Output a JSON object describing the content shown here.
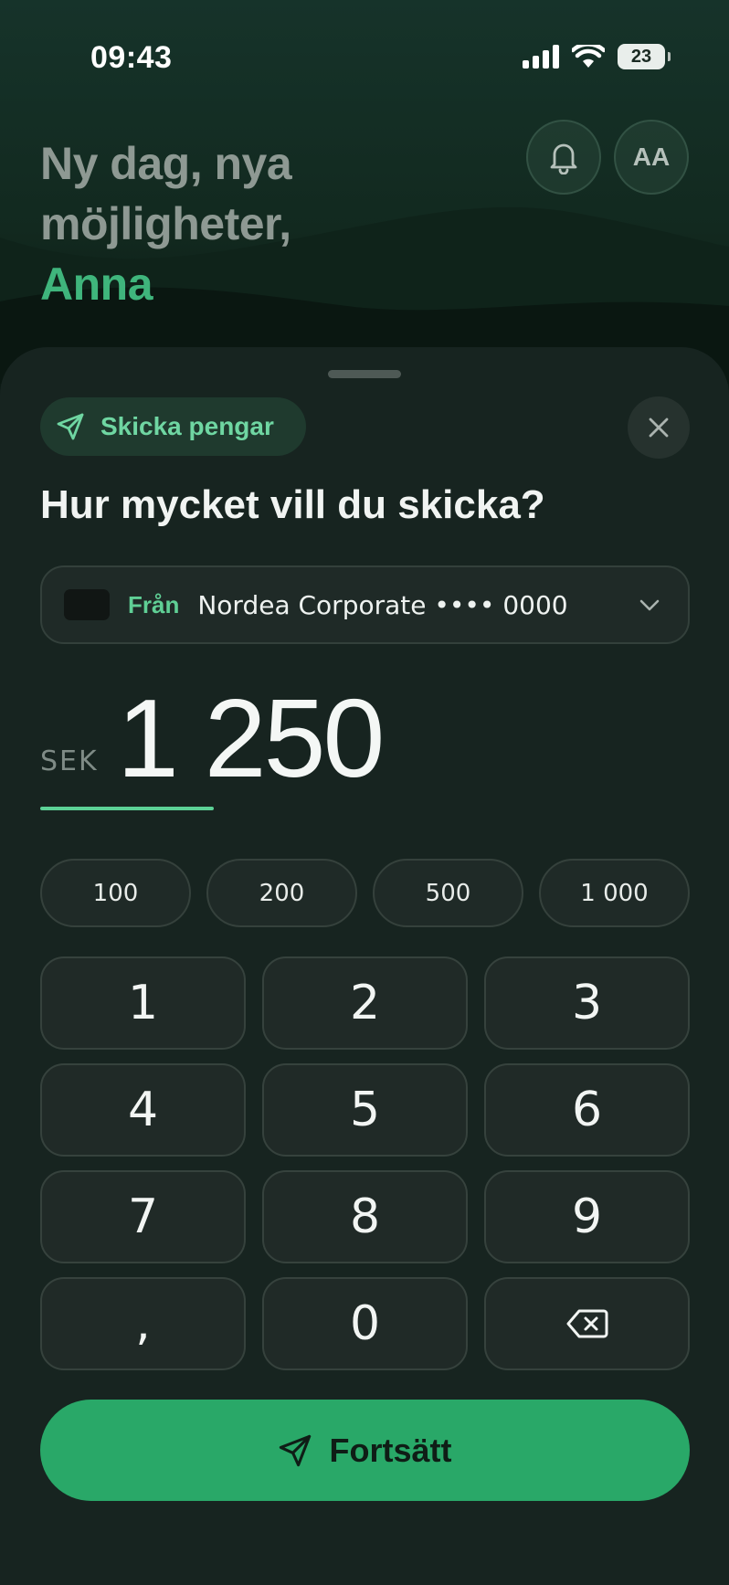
{
  "status_bar": {
    "time": "09:43",
    "battery": "23",
    "icons": [
      "signal-icon",
      "wifi-icon",
      "battery-icon"
    ]
  },
  "header": {
    "greeting_line1": "Ny dag, nya",
    "greeting_line2": "möjligheter,",
    "name": "Anna",
    "bell_icon": "bell-icon",
    "avatar_initials": "AA"
  },
  "sheet": {
    "chip_label": "Skicka pengar",
    "chip_icon": "send-icon",
    "close_icon": "close-icon",
    "question": "Hur mycket vill du skicka?",
    "from": {
      "label": "Från",
      "value": "Nordea Corporate •••• 0000",
      "icon": "chevron-down-icon"
    },
    "currency": "SEK",
    "amount": "1 250",
    "quick_amounts": [
      "100",
      "200",
      "500",
      "1 000"
    ],
    "keypad": [
      "1",
      "2",
      "3",
      "4",
      "5",
      "6",
      "7",
      "8",
      "9",
      ",",
      "0"
    ],
    "backspace_icon": "backspace-icon",
    "cta_label": "Fortsätt",
    "cta_icon": "send-icon"
  },
  "colors": {
    "accent": "#29a868",
    "accent_text": "#6fd6a2",
    "sheet_bg": "#172420",
    "header_bg": "#16332a"
  }
}
